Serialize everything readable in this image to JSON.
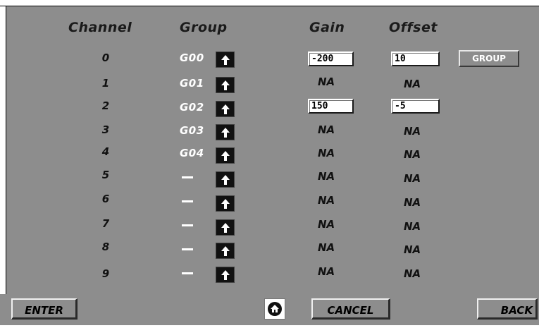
{
  "headers": {
    "channel": "Channel",
    "group": "Group",
    "gain": "Gain",
    "offset": "Offset"
  },
  "rows": [
    {
      "channel": "0",
      "group": "G00",
      "gain": "-200",
      "offset": "10"
    },
    {
      "channel": "1",
      "group": "G01",
      "gain": "NA",
      "offset": "NA"
    },
    {
      "channel": "2",
      "group": "G02",
      "gain": "150",
      "offset": "-5"
    },
    {
      "channel": "3",
      "group": "G03",
      "gain": "NA",
      "offset": "NA"
    },
    {
      "channel": "4",
      "group": "G04",
      "gain": "NA",
      "offset": "NA"
    },
    {
      "channel": "5",
      "group": "—",
      "gain": "NA",
      "offset": "NA"
    },
    {
      "channel": "6",
      "group": "—",
      "gain": "NA",
      "offset": "NA"
    },
    {
      "channel": "7",
      "group": "—",
      "gain": "NA",
      "offset": "NA"
    },
    {
      "channel": "8",
      "group": "—",
      "gain": "NA",
      "offset": "NA"
    },
    {
      "channel": "9",
      "group": "—",
      "gain": "NA",
      "offset": "NA"
    }
  ],
  "group_button": "GROUP",
  "buttons": {
    "enter": "ENTER",
    "cancel": "CANCEL",
    "back": "BACK"
  },
  "icons": {
    "home": "home-icon",
    "arrow": "arrow-up-icon"
  },
  "colors": {
    "panel": "#8d8d8d",
    "text_dark": "#111111",
    "text_light": "#ffffff"
  }
}
